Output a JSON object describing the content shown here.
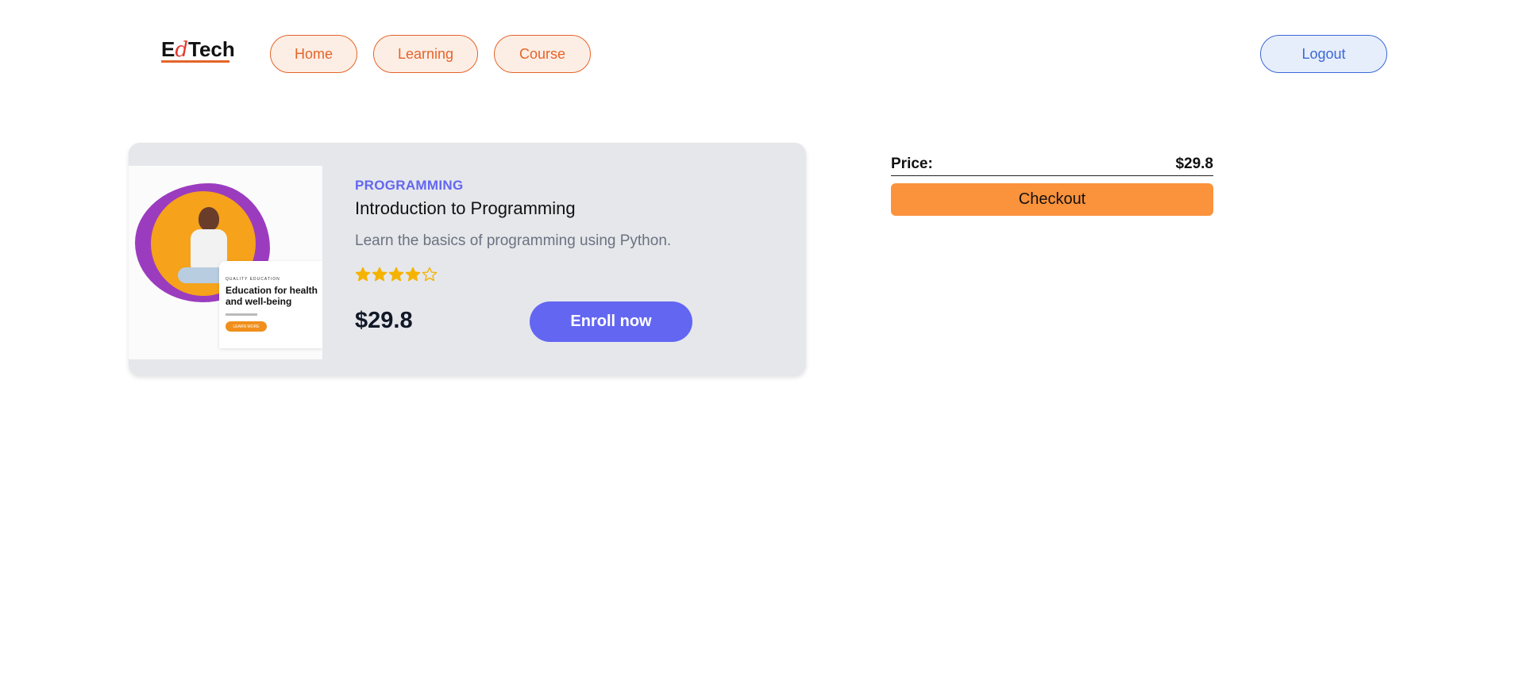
{
  "header": {
    "logo": {
      "prefix": "E",
      "accent": "d",
      "suffix": "Tech"
    },
    "nav": [
      {
        "label": "Home"
      },
      {
        "label": "Learning"
      },
      {
        "label": "Course"
      }
    ],
    "logout_label": "Logout"
  },
  "course": {
    "category": "PROGRAMMING",
    "title": "Introduction to Programming",
    "description": "Learn the basics of programming using Python.",
    "rating": 4,
    "rating_max": 5,
    "price": "$29.8",
    "enroll_label": "Enroll now",
    "thumbnail": {
      "tag": "QUALITY EDUCATION",
      "headline": "Education for health and well-being",
      "cta": "LEARN MORE"
    }
  },
  "checkout": {
    "price_label": "Price:",
    "price_value": "$29.8",
    "button_label": "Checkout"
  },
  "colors": {
    "nav_accent": "#e4642a",
    "nav_bg": "#fdeee5",
    "logout_accent": "#3a68d8",
    "logout_bg": "#e7eefb",
    "category": "#6366f1",
    "enroll_bg": "#6366f1",
    "star": "#f5b300",
    "checkout_bg": "#fb923c",
    "card_bg": "#e5e7eb"
  }
}
